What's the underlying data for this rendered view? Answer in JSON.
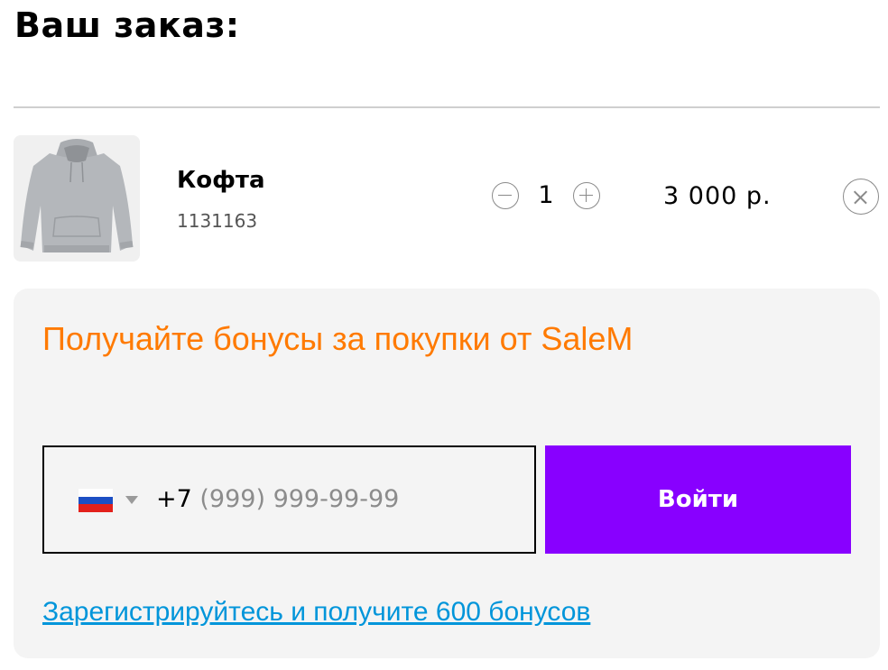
{
  "page": {
    "title": "Ваш заказ:"
  },
  "cart": {
    "items": [
      {
        "name": "Кофта",
        "sku": "1131163",
        "image_icon": "gray-hoodie-image",
        "quantity": "1",
        "price": "3 000 р."
      }
    ]
  },
  "bonus": {
    "title": "Получайте бонусы за покупки от SaleM",
    "title_color": "#ff7a00",
    "phone": {
      "country": "Russia",
      "flag_icon": "russia-flag-icon",
      "prefix": "+7",
      "placeholder": "(999) 999-99-99"
    },
    "login_label": "Войти",
    "login_color": "#8800ff",
    "register_link": "Зарегистрируйтесь и получите 600 бонусов",
    "link_color": "#0095da"
  }
}
